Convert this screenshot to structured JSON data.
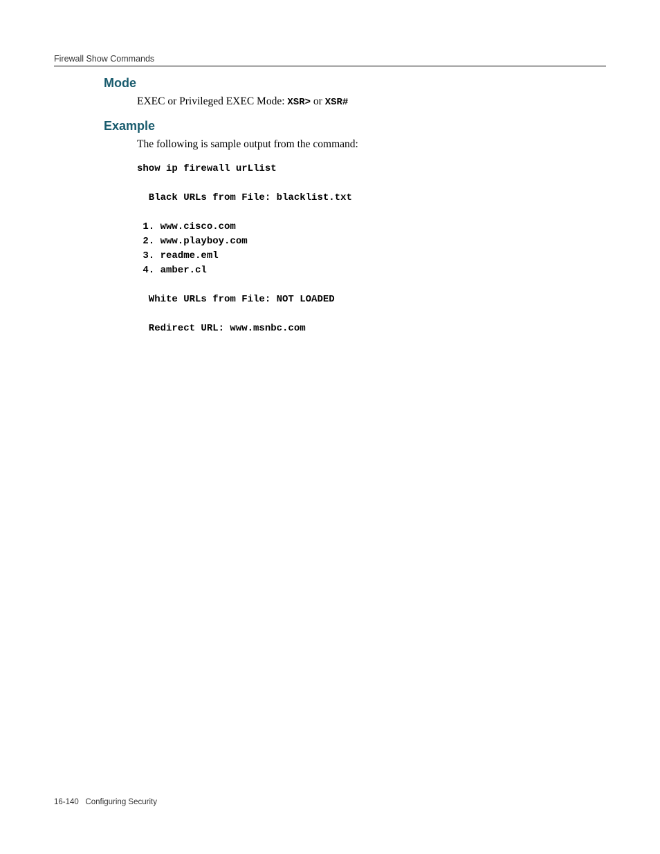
{
  "header": {
    "running_head": "Firewall Show Commands"
  },
  "sections": {
    "mode": {
      "heading": "Mode",
      "text_prefix": "EXEC or Privileged EXEC Mode:  ",
      "code1": "XSR>",
      "middle": " or ",
      "code2": "XSR#"
    },
    "example": {
      "heading": "Example",
      "intro": "The following is sample output from the command:",
      "code_lines": [
        "show ip firewall urLlist",
        "",
        "  Black URLs from File: blacklist.txt",
        "",
        " 1. www.cisco.com",
        " 2. www.playboy.com",
        " 3. readme.eml",
        " 4. amber.cl",
        "",
        "  White URLs from File: NOT LOADED",
        "",
        "  Redirect URL: www.msnbc.com"
      ]
    }
  },
  "footer": {
    "page_ref": "16-140",
    "chapter": "Configuring Security"
  }
}
